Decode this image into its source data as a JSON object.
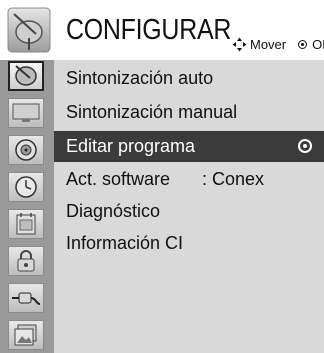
{
  "header": {
    "title": "CONFIGURAR",
    "move_label": "Mover",
    "ok_label": "OK"
  },
  "sidebar": {
    "items": [
      {
        "icon": "antenna-dish-icon",
        "active": true
      },
      {
        "icon": "screen-icon",
        "active": false
      },
      {
        "icon": "speaker-icon",
        "active": false
      },
      {
        "icon": "clock-icon",
        "active": false
      },
      {
        "icon": "calendar-icon",
        "active": false
      },
      {
        "icon": "lock-icon",
        "active": false
      },
      {
        "icon": "plug-icon",
        "active": false
      },
      {
        "icon": "photo-icon",
        "active": false
      }
    ]
  },
  "menu": {
    "items": [
      {
        "label": "Sintonización auto",
        "value": ""
      },
      {
        "label": "Sintonización manual",
        "value": ""
      },
      {
        "label": "Editar programa",
        "value": "",
        "selected": true
      },
      {
        "label": "Act. software",
        "value": ": Conex"
      },
      {
        "label": "Diagnóstico",
        "value": ""
      },
      {
        "label": "Información CI",
        "value": ""
      }
    ]
  },
  "colors": {
    "sidebar": "#9a9a9a",
    "menu_bg": "#d9d9d9",
    "selected_bg": "#3b3b3b"
  }
}
